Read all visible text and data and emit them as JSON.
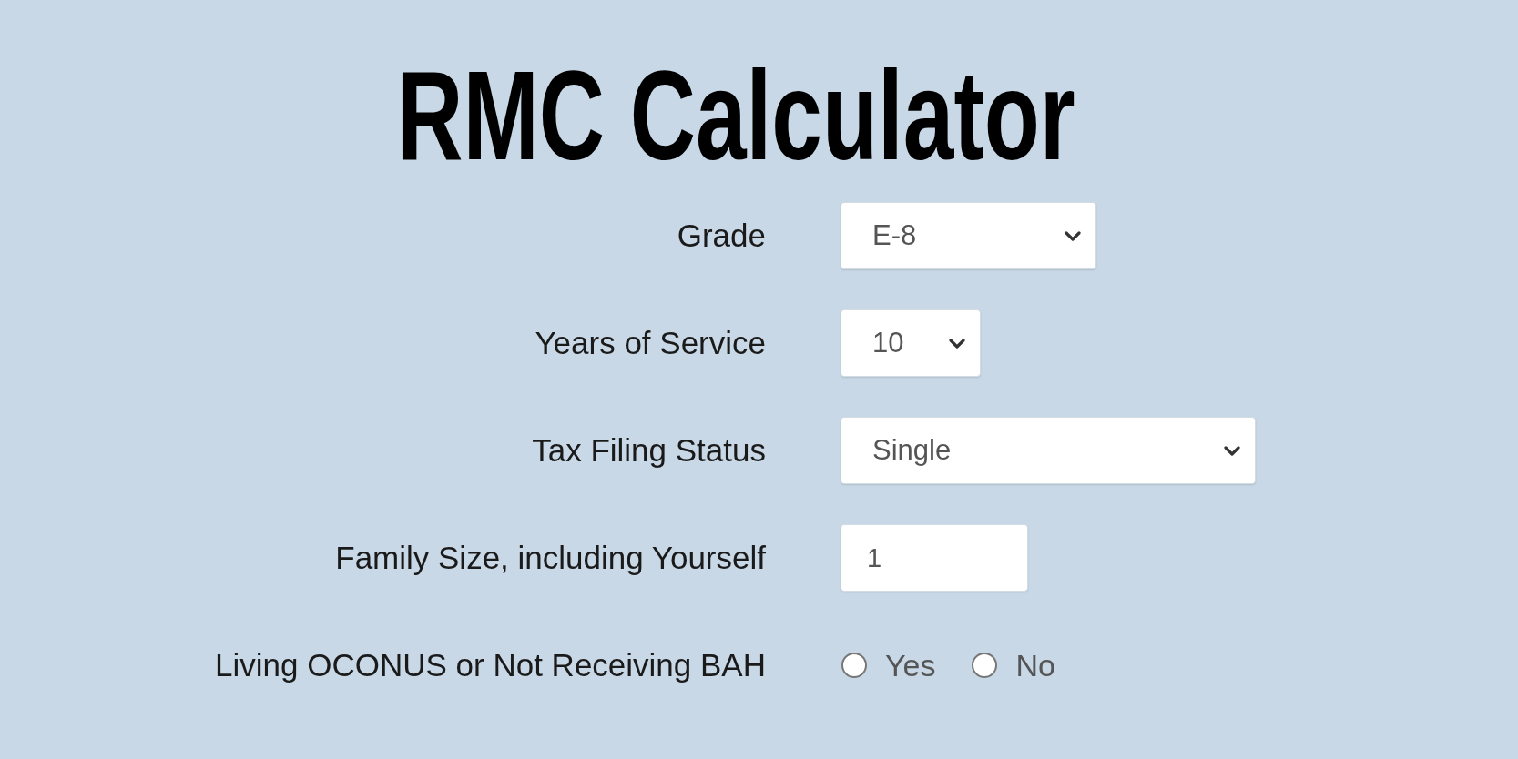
{
  "title": "RMC Calculator",
  "fields": [
    {
      "kind": "select",
      "label": "Grade",
      "value": "E-8"
    },
    {
      "kind": "select",
      "label": "Years of Service",
      "value": "10"
    },
    {
      "kind": "select",
      "label": "Tax Filing Status",
      "value": "Single"
    },
    {
      "kind": "input",
      "label": "Family Size, including Yourself",
      "value": "1"
    },
    {
      "kind": "radio",
      "label": "Living OCONUS or Not Receiving BAH",
      "options": [
        {
          "label": "Yes",
          "selected": false
        },
        {
          "label": "No",
          "selected": false
        }
      ]
    }
  ]
}
